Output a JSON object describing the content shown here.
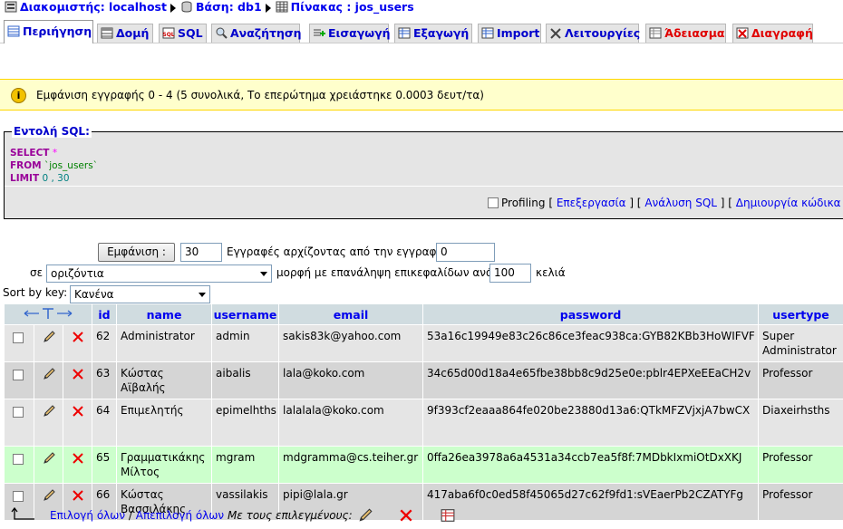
{
  "breadcrumb": {
    "server_label": "Διακομιστής: localhost",
    "db_label": "Βάση: db1",
    "table_label": "Πίνακας : jos_users"
  },
  "tabs": [
    {
      "label": "Περιήγηση",
      "icon": "browse-icon",
      "active": true
    },
    {
      "label": "Δομή",
      "icon": "structure-icon"
    },
    {
      "label": "SQL",
      "icon": "sql-icon"
    },
    {
      "label": "Αναζήτηση",
      "icon": "search-icon"
    },
    {
      "label": "Εισαγωγή",
      "icon": "insert-icon"
    },
    {
      "label": "Εξαγωγή",
      "icon": "export-icon"
    },
    {
      "label": "Import",
      "icon": "import-icon"
    },
    {
      "label": "Λειτουργίες",
      "icon": "operations-icon"
    },
    {
      "label": "Άδειασμα",
      "icon": "empty-icon",
      "danger": true
    },
    {
      "label": "Διαγραφή",
      "icon": "drop-icon",
      "danger": true
    }
  ],
  "notice": {
    "text": "Εμφάνιση εγγραφής 0 - 4 (5 συνολικά, Το επερώτημα χρειάστηκε 0.0003 δευτ/τα)"
  },
  "sql": {
    "legend": "Εντολή SQL:",
    "select_kw": "SELECT",
    "star": "*",
    "from_kw": "FROM",
    "table": "`jos_users`",
    "limit_kw": "LIMIT",
    "limit_vals": "0 , 30",
    "profiling": "Profiling",
    "edit_link": "Επεξεργασία",
    "explain_link": "Ανάλυση SQL",
    "php_link": "Δημιουργία κώδικα PHP"
  },
  "nav": {
    "show_button": "Εμφάνιση :",
    "rows_value": "30",
    "records_from": "Εγγραφές αρχίζοντας από την εγγραφή",
    "start_value": "0",
    "in_label": "σε",
    "mode_value": "οριζόντια",
    "mode_suffix": "μορφή με επανάληψη επικεφαλίδων ανά",
    "repeat_value": "100",
    "cells_label": "κελιά"
  },
  "sort": {
    "label": "Sort by key:",
    "value": "Κανένα"
  },
  "table": {
    "columns": [
      "id",
      "name",
      "username",
      "email",
      "password",
      "usertype"
    ],
    "rows": [
      {
        "id": "62",
        "name": "Administrator",
        "username": "admin",
        "email": "sakis83k@yahoo.com",
        "password": "53a16c19949e83c26c86ce3feac938ca:GYB82KBb3HoWIFVF",
        "usertype": "Super Administrator"
      },
      {
        "id": "63",
        "name": "Κώστας Αϊβαλής",
        "username": "aibalis",
        "email": "lala@koko.com",
        "password": "34c65d00d18a4e65fbe38bb8c9d25e0e:pblr4EPXeEEaCH2v",
        "usertype": "Professor"
      },
      {
        "id": "64",
        "name": "Επιμελητής",
        "username": "epimelhths",
        "email": "lalalala@koko.com",
        "password": "9f393cf2eaaa864fe020be23880d13a6:QTkMFZVjxjA7bwCX",
        "usertype": "Diaxeirhsths"
      },
      {
        "id": "65",
        "name": "Γραμματικάκης Μίλτος",
        "username": "mgram",
        "email": "mdgramma@cs.teiher.gr",
        "password": "0ffa26ea3978a6a4531a34ccb7ea5f8f:7MDbkIxmiOtDxXKJ",
        "usertype": "Professor"
      },
      {
        "id": "66",
        "name": "Κώστας Βασσιλάκης",
        "username": "vassilakis",
        "email": "pipi@lala.gr",
        "password": "417aba6f0c0ed58f45065d27c62f9fd1:sVEaerPb2CZATYFg",
        "usertype": "Professor"
      }
    ]
  },
  "footer": {
    "check_all": "Επιλογή όλων",
    "separator": "/",
    "uncheck_all": "Απεπιλογή όλων",
    "with_selected": "Με τους επιλεγμένους:"
  },
  "colors": {
    "link": "#0000cc",
    "danger": "#e00000",
    "header_bg": "#d0dce0",
    "marked_row": "#ccffcc",
    "notice_bg": "#ffffcc"
  }
}
